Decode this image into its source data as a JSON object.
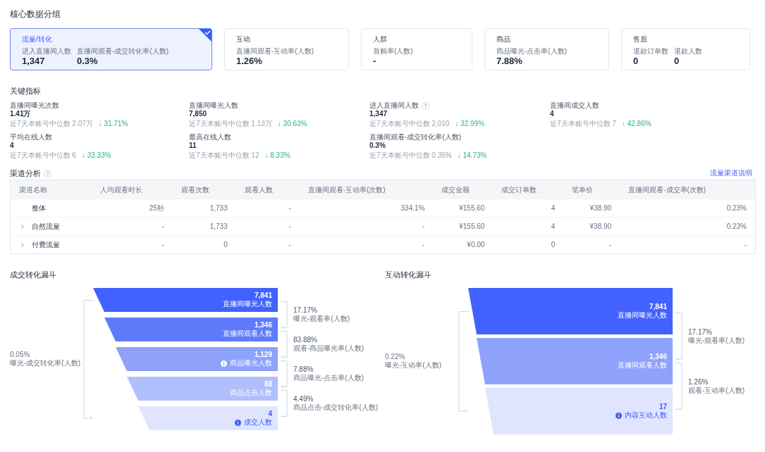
{
  "core_group": {
    "title": "核心数据分组",
    "cards": [
      {
        "title": "流量/转化",
        "selected": true,
        "metrics": [
          {
            "label": "进入直播间人数",
            "value": "1,347"
          },
          {
            "label": "直播间观看-成交转化率(人数)",
            "value": "0.3%"
          }
        ]
      },
      {
        "title": "互动",
        "selected": false,
        "metrics": [
          {
            "label": "直播间观看-互动率(人数)",
            "value": "1.26%"
          }
        ]
      },
      {
        "title": "人群",
        "selected": false,
        "metrics": [
          {
            "label": "首购率(人数)",
            "value": "-"
          }
        ]
      },
      {
        "title": "商品",
        "selected": false,
        "metrics": [
          {
            "label": "商品曝光-点击率(人数)",
            "value": "7.88%"
          }
        ]
      },
      {
        "title": "售后",
        "selected": false,
        "metrics": [
          {
            "label": "退款订单数",
            "value": "0"
          },
          {
            "label": "退款人数",
            "value": "0"
          }
        ]
      }
    ]
  },
  "key_metrics": {
    "title": "关键指标",
    "items": [
      {
        "label": "直播间曝光次数",
        "help": false,
        "value": "1.41万",
        "median": "近7天本账号中位数 2.07万",
        "change": "↓ 31.71%"
      },
      {
        "label": "直播间曝光人数",
        "help": false,
        "value": "7,850",
        "median": "近7天本账号中位数 1.13万",
        "change": "↓ 30.63%"
      },
      {
        "label": "进入直播间人数",
        "help": true,
        "value": "1,347",
        "median": "近7天本账号中位数 2,010",
        "change": "↓ 32.99%"
      },
      {
        "label": "直播间成交人数",
        "help": false,
        "value": "4",
        "median": "近7天本账号中位数 7",
        "change": "↓ 42.86%"
      },
      {
        "label": "平均在线人数",
        "help": false,
        "value": "4",
        "median": "近7天本账号中位数 6",
        "change": "↓ 33.33%"
      },
      {
        "label": "最高在线人数",
        "help": false,
        "value": "11",
        "median": "近7天本账号中位数 12",
        "change": "↓ 8.33%"
      },
      {
        "label": "直播间观看-成交转化率(人数)",
        "help": false,
        "value": "0.3%",
        "median": "近7天本账号中位数 0.35%",
        "change": "↓ 14.73%"
      }
    ]
  },
  "channel_analysis": {
    "title": "渠道分析",
    "link": "流量渠道说明",
    "columns": [
      "渠道名称",
      "人均观看时长",
      "观看次数",
      "观看人数",
      "直播间观看-互动率(次数)",
      "成交金额",
      "成交订单数",
      "笔单价",
      "直播间观看-成交率(次数)"
    ],
    "rows": [
      {
        "kind": "total",
        "cells": [
          "整体",
          "25秒",
          "1,733",
          "-",
          "334.1%",
          "¥155.60",
          "4",
          "¥38.90",
          "0.23%"
        ]
      },
      {
        "kind": "channel",
        "expanded": false,
        "cells": [
          "自然流量",
          "-",
          "1,733",
          "-",
          "-",
          "¥155.60",
          "4",
          "¥38.90",
          "0.23%"
        ]
      },
      {
        "kind": "channel",
        "expanded": false,
        "cells": [
          "付费流量",
          "-",
          "0",
          "-",
          "-",
          "¥0.00",
          "0",
          "-",
          "-"
        ]
      }
    ]
  },
  "funnels": [
    {
      "title": "成交转化漏斗",
      "overall_rate": "0.05%",
      "overall_label": "曝光-成交转化率(人数)",
      "stages": [
        {
          "value": "7,841",
          "label": "直播间曝光人数",
          "info": false,
          "color": "#4262ff"
        },
        {
          "value": "1,346",
          "label": "直播间观看人数",
          "info": false,
          "color": "#5f7bfc"
        },
        {
          "value": "1,129",
          "label": "商品曝光人数",
          "info": true,
          "color": "#8ea2fc"
        },
        {
          "value": "88",
          "label": "商品点击人数",
          "info": false,
          "color": "#b1bffc"
        },
        {
          "value": "4",
          "label": "成交人数",
          "info": true,
          "color": "#dfe5fe"
        }
      ],
      "rates": [
        {
          "rate": "17.17%",
          "label": "曝光-观看率(人数)"
        },
        {
          "rate": "83.88%",
          "label": "观看-商品曝光率(人数)"
        },
        {
          "rate": "7.88%",
          "label": "商品曝光-点击率(人数)"
        },
        {
          "rate": "4.49%",
          "label": "商品点击-成交转化率(人数)"
        }
      ]
    },
    {
      "title": "互动转化漏斗",
      "overall_rate": "0.22%",
      "overall_label": "曝光-互动率(人数)",
      "stages": [
        {
          "value": "7,841",
          "label": "直播间曝光人数",
          "info": false,
          "color": "#4262ff"
        },
        {
          "value": "1,346",
          "label": "直播间观看人数",
          "info": false,
          "color": "#8ea2fc"
        },
        {
          "value": "17",
          "label": "内容互动人数",
          "info": true,
          "color": "#dfe5fe"
        }
      ],
      "rates": [
        {
          "rate": "17.17%",
          "label": "曝光-观看率(人数)"
        },
        {
          "rate": "1.26%",
          "label": "观看-互动率(人数)"
        }
      ]
    }
  ]
}
